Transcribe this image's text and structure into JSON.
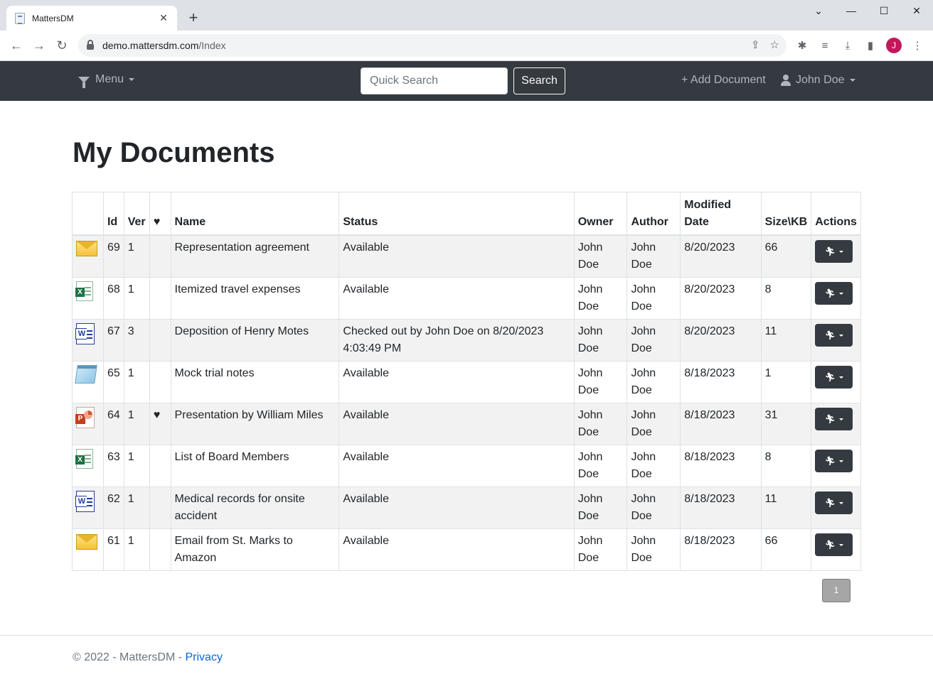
{
  "browser": {
    "tab_title": "MattersDM",
    "tab_close": "✕",
    "new_tab": "+",
    "url_host": "demo.mattersdm.com",
    "url_path": "/Index",
    "avatar_letter": "J"
  },
  "navbar": {
    "menu_label": "Menu",
    "search_placeholder": "Quick Search",
    "search_button": "Search",
    "add_document": "+ Add Document",
    "user_name": "John Doe",
    "bg_color": "#343a40"
  },
  "page": {
    "title": "My Documents"
  },
  "table": {
    "headers": {
      "icon": "",
      "id": "Id",
      "ver": "Ver",
      "fav": "♥",
      "name": "Name",
      "status": "Status",
      "owner": "Owner",
      "author": "Author",
      "modified": "Modified Date",
      "size": "Size\\KB",
      "actions": "Actions"
    },
    "rows": [
      {
        "icon": "email-icon",
        "id": "69",
        "ver": "1",
        "fav": "",
        "name": "Representation agreement",
        "status": "Available",
        "owner": "John Doe",
        "author": "John Doe",
        "modified": "8/20/2023",
        "size": "66"
      },
      {
        "icon": "excel-icon",
        "id": "68",
        "ver": "1",
        "fav": "",
        "name": "Itemized travel expenses",
        "status": "Available",
        "owner": "John Doe",
        "author": "John Doe",
        "modified": "8/20/2023",
        "size": "8"
      },
      {
        "icon": "word-icon",
        "id": "67",
        "ver": "3",
        "fav": "",
        "name": "Deposition of Henry Motes",
        "status": "Checked out by John Doe on 8/20/2023 4:03:49 PM",
        "owner": "John Doe",
        "author": "John Doe",
        "modified": "8/20/2023",
        "size": "11"
      },
      {
        "icon": "notepad-icon",
        "id": "65",
        "ver": "1",
        "fav": "",
        "name": "Mock trial notes",
        "status": "Available",
        "owner": "John Doe",
        "author": "John Doe",
        "modified": "8/18/2023",
        "size": "1"
      },
      {
        "icon": "powerpoint-icon",
        "id": "64",
        "ver": "1",
        "fav": "♥",
        "name": "Presentation by William Miles",
        "status": "Available",
        "owner": "John Doe",
        "author": "John Doe",
        "modified": "8/18/2023",
        "size": "31"
      },
      {
        "icon": "excel-icon",
        "id": "63",
        "ver": "1",
        "fav": "",
        "name": "List of Board Members",
        "status": "Available",
        "owner": "John Doe",
        "author": "John Doe",
        "modified": "8/18/2023",
        "size": "8"
      },
      {
        "icon": "word-icon",
        "id": "62",
        "ver": "1",
        "fav": "",
        "name": "Medical records for onsite accident",
        "status": "Available",
        "owner": "John Doe",
        "author": "John Doe",
        "modified": "8/18/2023",
        "size": "11"
      },
      {
        "icon": "email-icon",
        "id": "61",
        "ver": "1",
        "fav": "",
        "name": "Email from St. Marks to Amazon",
        "status": "Available",
        "owner": "John Doe",
        "author": "John Doe",
        "modified": "8/18/2023",
        "size": "66"
      }
    ]
  },
  "pagination": {
    "current_page": "1"
  },
  "footer": {
    "copyright": "© 2022 - MattersDM - ",
    "privacy_link": "Privacy"
  }
}
